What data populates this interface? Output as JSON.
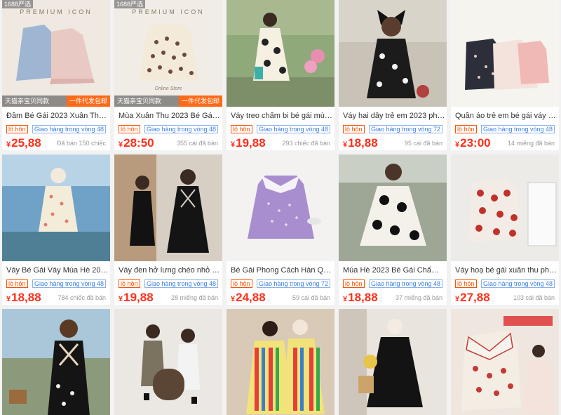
{
  "products": [
    {
      "title": "Đầm Bé Gái 2023 Xuân Thu Tr...",
      "tag1": "lô hôn",
      "tag2": "Giao hàng trong vòng 48",
      "price": "25,88",
      "sold": "Đã bán 150 chiếc",
      "badge": "1688严选",
      "overlay": "PREMIUM ICON",
      "strip_left": "天猫亲宝贝同款",
      "strip_right": "一件代发包邮"
    },
    {
      "title": "Mùa Xuân Thu 2023 Bé Gái Ph...",
      "tag1": "lô hôn",
      "tag2": "Giao hàng trong vòng 48",
      "price": "28:50",
      "sold": "355 cái đã bán",
      "badge": "1688严选",
      "overlay": "PREMIUM ICON",
      "strip_left": "天猫亲宝贝同款",
      "strip_right": "一件代发包邮"
    },
    {
      "title": "Váy treo chấm bi bé gái mùa h...",
      "tag1": "lô hôn",
      "tag2": "Giao hàng trong vòng 48",
      "price": "19,88",
      "sold": "293 chiếc đã bán"
    },
    {
      "title": "Váy hai dây trẻ em 2023 phon...",
      "tag1": "lô hôn",
      "tag2": "Giao hàng trong vòng 72",
      "price": "18,88",
      "sold": "95 cái đã bán"
    },
    {
      "title": "Quần áo trẻ em bé gái váy hoa ...",
      "tag1": "lô hôn",
      "tag2": "Giao hàng trong vòng 48",
      "price": "23:00",
      "sold": "14 miếng đã bán"
    },
    {
      "title": "Váy Bé Gái Váy Mùa Hè 2023 C...",
      "tag1": "lô hôn",
      "tag2": "Giao hàng trong vòng 48",
      "price": "18,88",
      "sold": "784 chiếc đã bán"
    },
    {
      "title": "Váy đen hở lưng chéo nhỏ dành...",
      "tag1": "lô hôn",
      "tag2": "Giao hàng trong vòng 48",
      "price": "19,88",
      "sold": "28 miếng đã bán"
    },
    {
      "title": "Bé Gái Phong Cách Hàn Quốc ...",
      "tag1": "lô hôn",
      "tag2": "Giao hàng trong vòng 72",
      "price": "24,88",
      "sold": "59 cái đã bán"
    },
    {
      "title": "Mùa Hè 2023 Bé Gái Chấm Bi ...",
      "tag1": "lô hôn",
      "tag2": "Giao hàng trong vòng 48",
      "price": "18,88",
      "sold": "37 miếng đã bán"
    },
    {
      "title": "Váy hoạ bé gái xuân thu phong ...",
      "tag1": "lô hôn",
      "tag2": "Giao hàng trong vòng 48",
      "price": "27,88",
      "sold": "103 cái đã bán"
    },
    {
      "title": "",
      "tag1": "",
      "tag2": "",
      "price": "",
      "sold": ""
    },
    {
      "title": "",
      "tag1": "",
      "tag2": "",
      "price": "",
      "sold": ""
    },
    {
      "title": "",
      "tag1": "",
      "tag2": "",
      "price": "",
      "sold": ""
    },
    {
      "title": "",
      "tag1": "",
      "tag2": "",
      "price": "",
      "sold": ""
    },
    {
      "title": "",
      "tag1": "",
      "tag2": "",
      "price": "",
      "sold": ""
    }
  ],
  "currency": "¥",
  "colors": {
    "price": "#ff2f1a",
    "tag_lo": "#ff5000",
    "tag_ship": "#3c7fe0",
    "strip_badge": "#ff6a1a"
  }
}
